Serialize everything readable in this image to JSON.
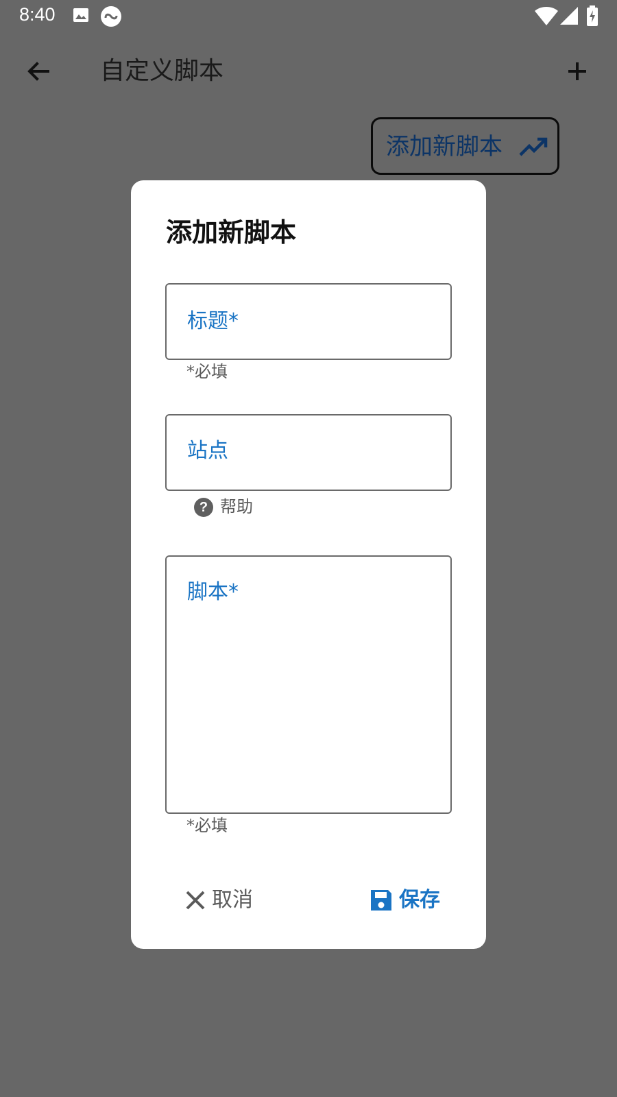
{
  "status_bar": {
    "time": "8:40",
    "icons": [
      "image-icon",
      "sync-icon",
      "wifi-icon",
      "signal-icon",
      "battery-charging-icon"
    ]
  },
  "app_bar": {
    "title": "自定义脚本",
    "back_icon": "arrow-back-icon",
    "add_icon": "plus-icon"
  },
  "background_button": {
    "label": "添加新脚本",
    "icon": "trending-up-icon"
  },
  "dialog": {
    "title": "添加新脚本",
    "fields": {
      "title": {
        "label": "标题*",
        "value": "",
        "helper": "*必填"
      },
      "site": {
        "label": "站点",
        "value": "",
        "help_label": "帮助",
        "help_icon_glyph": "?"
      },
      "script": {
        "label": "脚本*",
        "value": "",
        "helper": "*必填"
      }
    },
    "actions": {
      "cancel": {
        "label": "取消",
        "icon": "close-icon"
      },
      "save": {
        "label": "保存",
        "icon": "floppy-disk-icon"
      }
    }
  },
  "colors": {
    "scrim": "#676767",
    "accent": "#1a74c4",
    "dialog_bg": "#ffffff",
    "outline": "#6a6a6a"
  }
}
